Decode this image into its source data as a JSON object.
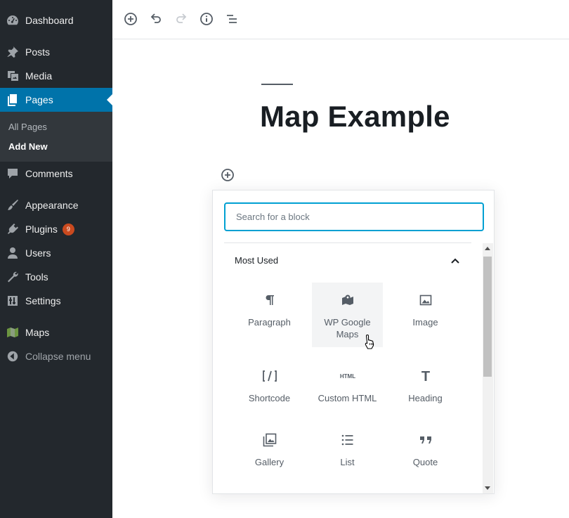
{
  "sidebar": {
    "items": [
      {
        "label": "Dashboard",
        "icon": "dashboard-icon"
      },
      {
        "label": "Posts",
        "icon": "pin-icon"
      },
      {
        "label": "Media",
        "icon": "media-icon"
      },
      {
        "label": "Pages",
        "icon": "pages-icon"
      },
      {
        "label": "Comments",
        "icon": "comment-icon"
      },
      {
        "label": "Appearance",
        "icon": "brush-icon"
      },
      {
        "label": "Plugins",
        "icon": "plugin-icon",
        "badge": "9"
      },
      {
        "label": "Users",
        "icon": "user-icon"
      },
      {
        "label": "Tools",
        "icon": "wrench-icon"
      },
      {
        "label": "Settings",
        "icon": "sliders-icon"
      },
      {
        "label": "Maps",
        "icon": "map-icon"
      },
      {
        "label": "Collapse menu",
        "icon": "collapse-arrow-icon"
      }
    ],
    "submenu": [
      {
        "label": "All Pages"
      },
      {
        "label": "Add New"
      }
    ],
    "active": "Pages"
  },
  "editor": {
    "title": "Map Example"
  },
  "inserter": {
    "search_placeholder": "Search for a block",
    "panel_title": "Most Used",
    "blocks": [
      {
        "label": "Paragraph",
        "icon": "paragraph-icon"
      },
      {
        "label": "WP Google Maps",
        "icon": "map-pin-icon"
      },
      {
        "label": "Image",
        "icon": "image-icon"
      },
      {
        "label": "Shortcode",
        "icon": "shortcode-icon"
      },
      {
        "label": "Custom HTML",
        "icon": "html-icon",
        "icon_text": "HTML"
      },
      {
        "label": "Heading",
        "icon": "heading-icon",
        "icon_text": "T"
      },
      {
        "label": "Gallery",
        "icon": "gallery-icon"
      },
      {
        "label": "List",
        "icon": "list-icon"
      },
      {
        "label": "Quote",
        "icon": "quote-icon"
      }
    ]
  },
  "colors": {
    "sidebar_bg": "#23282d",
    "active_bg": "#0073aa",
    "badge": "#ca4a1f",
    "focus": "#00a0d2"
  }
}
